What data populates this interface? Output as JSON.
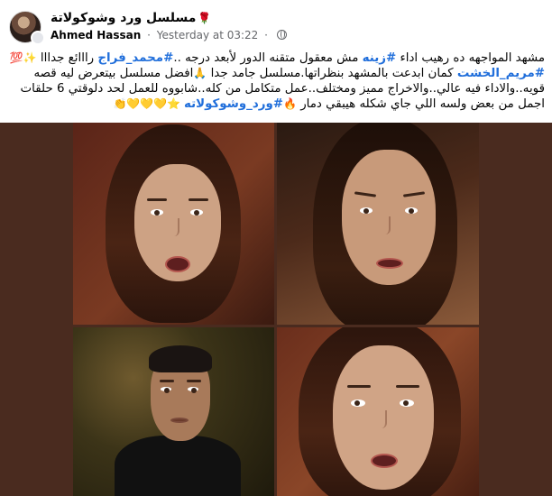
{
  "header": {
    "group_name": "مسلسل ورد وشوكولاتة",
    "group_emoji": "🌹",
    "author": "Ahmed Hassan",
    "separator": "·",
    "timestamp": "Yesterday at 03:22",
    "avatar_icon": "group-avatar",
    "privacy_icon": "globe-icon"
  },
  "post": {
    "line1_a": "مشهد المواجهه ده رهيب اداء ",
    "line1_tag1": "#زينه",
    "line1_b": " مش معقول متقنه الدور لأبعد درجه ..",
    "line1_tag2": "#محمد_فراج",
    "line1_c": " رااائع جدااا ",
    "line1_emoji": "✨💯",
    "line2_tag": "#مريم_الخشت",
    "line2_a": " كمان ابدعت بالمشهد بنظراتها.مسلسل جامد جدا ",
    "line2_emoji": "🙏",
    "line2_b": "افضل مسلسل بيتعرض ليه قصه",
    "line3": "قويه..والاداء فيه عالي..والاخراج مميز ومختلف..عمل متكامل من كله..شابووه للعمل لحد دلوقتي 6 حلقات",
    "line4_a": "اجمل من بعض ولسه اللي جاي شكله هيبقي دمار ",
    "line4_fire": "🔥",
    "line4_tag": "#ورد_وشوكولاته",
    "line4_emoji": " ⭐💛💛💛👏"
  },
  "media": {
    "background_color": "#4a2b1f",
    "tiles": [
      {
        "name": "woman-surprised-left"
      },
      {
        "name": "woman-confronting"
      },
      {
        "name": "man-in-dark-suit"
      },
      {
        "name": "woman-surprised-closeup"
      }
    ]
  }
}
